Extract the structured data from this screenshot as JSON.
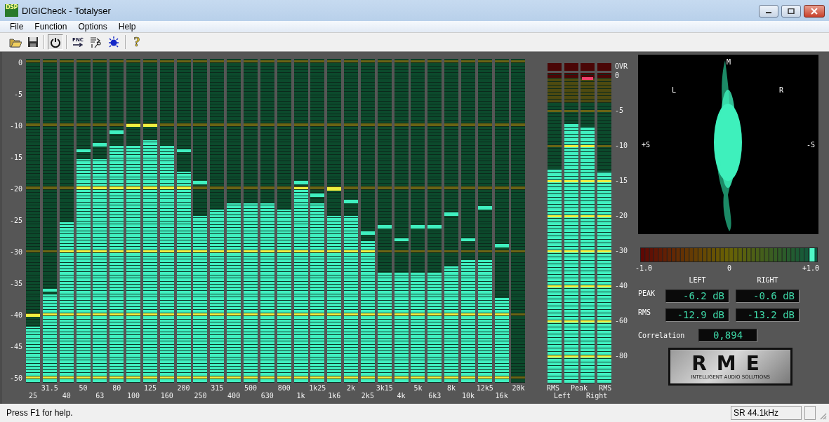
{
  "window": {
    "title": "DIGICheck - Totalyser",
    "app_icon_label": "DSP"
  },
  "menu": [
    "File",
    "Function",
    "Options",
    "Help"
  ],
  "toolbar": [
    {
      "kind": "open",
      "pressed": false
    },
    {
      "kind": "save",
      "pressed": false
    },
    {
      "kind": "power",
      "pressed": true
    },
    {
      "kind": "fnc",
      "label": "FNC",
      "pressed": false
    },
    {
      "kind": "io",
      "pressed": false
    },
    {
      "kind": "light",
      "pressed": false
    },
    {
      "kind": "help",
      "label": "?",
      "pressed": false
    }
  ],
  "spectrum": {
    "scale": [
      "0",
      "-5",
      "-10",
      "-15",
      "-20",
      "-25",
      "-30",
      "-35",
      "-40",
      "-45",
      "-50"
    ],
    "bands": [
      {
        "label": "25",
        "level": 0.174,
        "peak": {
          "level": 0.208
        }
      },
      {
        "label": "31.5",
        "level": 0.272,
        "peak": {
          "level": 0.286
        }
      },
      {
        "label": "40",
        "level": 0.496
      },
      {
        "label": "50",
        "level": 0.691,
        "peak": {
          "level": 0.716
        }
      },
      {
        "label": "63",
        "level": 0.691,
        "peak": {
          "level": 0.735
        }
      },
      {
        "label": "80",
        "level": 0.731,
        "peak": {
          "level": 0.774
        }
      },
      {
        "label": "100",
        "level": 0.731,
        "peak": {
          "level": 0.794
        }
      },
      {
        "label": "125",
        "level": 0.75,
        "peak": {
          "level": 0.794
        }
      },
      {
        "label": "160",
        "level": 0.731
      },
      {
        "label": "200",
        "level": 0.652,
        "peak": {
          "level": 0.716
        }
      },
      {
        "label": "250",
        "level": 0.516,
        "peak": {
          "level": 0.618
        }
      },
      {
        "label": "315",
        "level": 0.535
      },
      {
        "label": "400",
        "level": 0.555
      },
      {
        "label": "500",
        "level": 0.555
      },
      {
        "label": "630",
        "level": 0.555
      },
      {
        "label": "800",
        "level": 0.535
      },
      {
        "label": "1k",
        "level": 0.604,
        "peak": {
          "level": 0.618
        }
      },
      {
        "label": "1k25",
        "level": 0.555,
        "peak": {
          "level": 0.579
        }
      },
      {
        "label": "1k6",
        "level": 0.516,
        "peak": {
          "level": 0.599
        }
      },
      {
        "label": "2k",
        "level": 0.516,
        "peak": {
          "level": 0.56
        }
      },
      {
        "label": "2k5",
        "level": 0.438,
        "peak": {
          "level": 0.462
        }
      },
      {
        "label": "3k15",
        "level": 0.34,
        "peak": {
          "level": 0.482
        }
      },
      {
        "label": "4k",
        "level": 0.34,
        "peak": {
          "level": 0.442
        }
      },
      {
        "label": "5k",
        "level": 0.34,
        "peak": {
          "level": 0.482
        }
      },
      {
        "label": "6k3",
        "level": 0.34,
        "peak": {
          "level": 0.482
        }
      },
      {
        "label": "8k",
        "level": 0.36,
        "peak": {
          "level": 0.521
        }
      },
      {
        "label": "10k",
        "level": 0.379,
        "peak": {
          "level": 0.442
        }
      },
      {
        "label": "12k5",
        "level": 0.379,
        "peak": {
          "level": 0.54
        }
      },
      {
        "label": "16k",
        "level": 0.262,
        "peak": {
          "level": 0.423
        }
      },
      {
        "label": "20k"
      }
    ]
  },
  "level_meter": {
    "scale": [
      "OVR",
      "0",
      "-5",
      "-10",
      "-15",
      "-20",
      "-30",
      "-40",
      "-60",
      "-80"
    ],
    "meters": [
      {
        "level": 0.691,
        "peak_hold": false
      },
      {
        "level": 0.837,
        "peak_hold": false
      },
      {
        "level": 0.826,
        "peak_hold": true
      },
      {
        "level": 0.682,
        "peak_hold": false
      }
    ],
    "type_labels": [
      "RMS",
      "Peak",
      "RMS"
    ],
    "channel_labels": [
      "Left",
      "Right"
    ]
  },
  "vectorscope": {
    "labels": {
      "top": "M",
      "upper_left": "L",
      "upper_right": "R",
      "left": "+S",
      "right": "-S"
    }
  },
  "correlation_meter": {
    "level": 0.97,
    "labels": [
      "-1.0",
      "0",
      "+1.0"
    ]
  },
  "readouts": {
    "columns": [
      "LEFT",
      "RIGHT"
    ],
    "rows": [
      {
        "label": "PEAK",
        "values": [
          "-6.2 dB",
          "-0.6 dB"
        ]
      },
      {
        "label": "RMS",
        "values": [
          "-12.9 dB",
          "-13.2 dB"
        ]
      }
    ],
    "correlation_label": "Correlation",
    "correlation_value": "0,894"
  },
  "logo": {
    "name": "RME",
    "tagline": "INTELLIGENT AUDIO SOLUTIONS"
  },
  "status_bar": {
    "message": "Press F1 for help.",
    "sample_rate": "SR 44.1kHz"
  }
}
